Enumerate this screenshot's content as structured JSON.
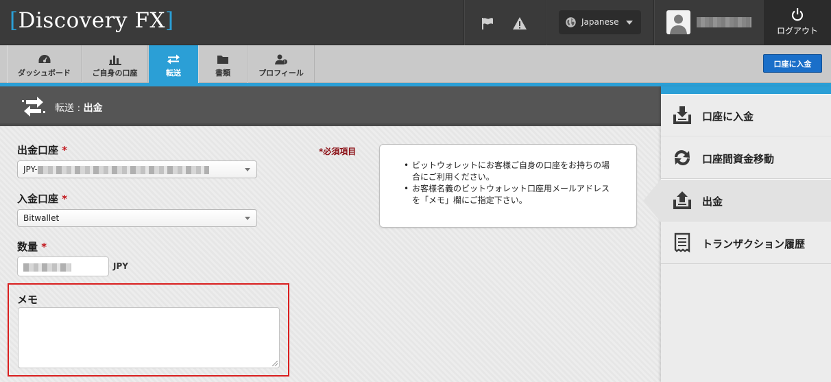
{
  "header": {
    "logo_text": "Discovery FX",
    "language": "Japanese",
    "logout_label": "ログアウト"
  },
  "nav": {
    "tabs": [
      {
        "label": "ダッシュボード",
        "icon": "dashboard-icon"
      },
      {
        "label": "ご自身の口座",
        "icon": "bar-chart-icon"
      },
      {
        "label": "転送",
        "icon": "transfer-icon",
        "active": true
      },
      {
        "label": "書類",
        "icon": "folder-icon"
      },
      {
        "label": "プロフィール",
        "icon": "profile-icon"
      }
    ],
    "deposit_button": "口座に入金"
  },
  "page": {
    "section": "転送",
    "separator": " : ",
    "title": "出金"
  },
  "form": {
    "required_note": "*必須項目",
    "from_account_label": "出金口座",
    "from_account_prefix": "JPY-",
    "to_account_label": "入金口座",
    "to_account_value": "Bitwallet",
    "quantity_label": "数量",
    "quantity_unit": "JPY",
    "memo_label": "メモ",
    "required_mark": "*"
  },
  "info": {
    "items": [
      "ビットウォレットにお客様ご自身の口座をお持ちの場合にご利用ください。",
      "お客様名義のビットウォレット口座用メールアドレスを「メモ」欄にご指定下さい。"
    ]
  },
  "side_menu": {
    "items": [
      {
        "label": "口座に入金",
        "icon": "deposit-icon"
      },
      {
        "label": "口座間資金移動",
        "icon": "transfer-arrows-icon"
      },
      {
        "label": "出金",
        "icon": "withdraw-icon",
        "active": true
      },
      {
        "label": "トランザクション履歴",
        "icon": "receipt-icon"
      }
    ]
  },
  "colors": {
    "accent": "#2b9fd6",
    "header_bg": "#3a3a3a",
    "deposit_button": "#1a6fc9",
    "required": "#c2151b",
    "highlight_border": "#d91e1e"
  }
}
